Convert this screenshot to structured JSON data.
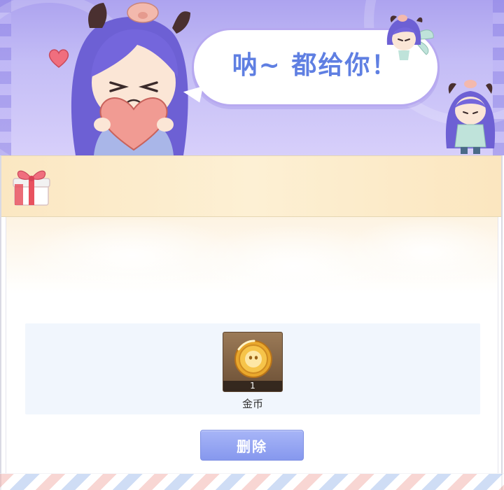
{
  "banner": {
    "speech_text": "呐~ 都给你！"
  },
  "reward": {
    "item_count": "1",
    "item_name": "金币"
  },
  "actions": {
    "delete_label": "删除"
  },
  "colors": {
    "accent": "#8698ee",
    "banner_purple": "#ada3ef",
    "speech_text": "#5f7fe2",
    "header_cream": "#fbe7c2"
  },
  "icons": {
    "gift": "gift-box-icon",
    "coin": "gold-coin-icon",
    "heart": "heart-icon"
  }
}
